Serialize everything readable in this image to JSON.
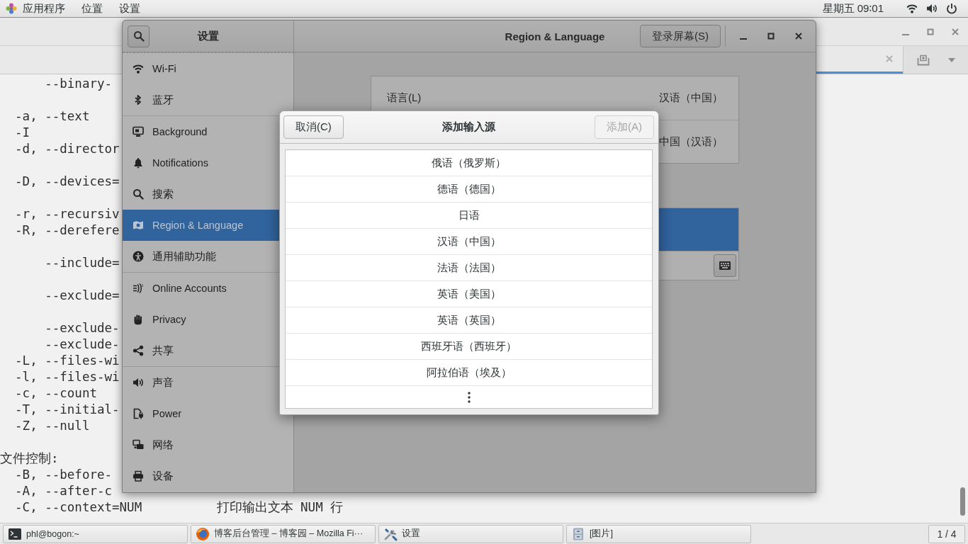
{
  "top_bar": {
    "menus": [
      "应用程序",
      "位置",
      "设置"
    ],
    "clock": "星期五 09∶01"
  },
  "terminal": {
    "tabs": [
      {
        "selected": true
      }
    ],
    "lines": [
      {
        "kind": "long",
        "text": "--binary-"
      },
      {
        "kind": "blank"
      },
      {
        "kind": "short",
        "text": "-a, --text"
      },
      {
        "kind": "short",
        "text": "-I"
      },
      {
        "kind": "short",
        "text": "-d, --director"
      },
      {
        "kind": "blank"
      },
      {
        "kind": "short",
        "text": "-D, --devices="
      },
      {
        "kind": "blank"
      },
      {
        "kind": "short",
        "text": "-r, --recursiv"
      },
      {
        "kind": "short",
        "text": "-R, --derefere"
      },
      {
        "kind": "blank"
      },
      {
        "kind": "long",
        "text": "--include="
      },
      {
        "kind": "blank"
      },
      {
        "kind": "long",
        "text": "--exclude="
      },
      {
        "kind": "blank"
      },
      {
        "kind": "long",
        "text": "--exclude-"
      },
      {
        "kind": "long",
        "text": "--exclude-"
      },
      {
        "kind": "short",
        "text": "-L, --files-wi"
      },
      {
        "kind": "short",
        "text": "-l, --files-wi"
      },
      {
        "kind": "short",
        "text": "-c, --count"
      },
      {
        "kind": "short",
        "text": "-T, --initial-"
      },
      {
        "kind": "short",
        "text": "-Z, --null"
      },
      {
        "kind": "blank"
      },
      {
        "kind": "heading",
        "text": "文件控制:"
      },
      {
        "kind": "short",
        "text": "-B, --before-"
      },
      {
        "kind": "short",
        "text": "-A, --after-c"
      },
      {
        "kind": "short",
        "text": "-C, --context=NUM",
        "description": "打印输出文本 NUM 行"
      }
    ]
  },
  "settings": {
    "title": "设置",
    "page_title": "Region & Language",
    "login_screen_button": "登录屏幕(S)",
    "sidebar_groups": [
      {
        "items": [
          {
            "label": "Wi-Fi",
            "selected": false
          },
          {
            "label": "蓝牙",
            "selected": false
          }
        ]
      },
      {
        "items": [
          {
            "label": "Background",
            "selected": false
          },
          {
            "label": "Notifications",
            "selected": false
          },
          {
            "label": "搜索",
            "selected": false
          },
          {
            "label": "Region & Language",
            "selected": true
          },
          {
            "label": "通用辅助功能",
            "selected": false
          }
        ]
      },
      {
        "items": [
          {
            "label": "Online Accounts",
            "selected": false
          },
          {
            "label": "Privacy",
            "selected": false
          },
          {
            "label": "共享",
            "selected": false
          }
        ]
      },
      {
        "items": [
          {
            "label": "声音",
            "selected": false
          },
          {
            "label": "Power",
            "selected": false
          },
          {
            "label": "网络",
            "selected": false
          },
          {
            "label": "设备",
            "selected": false
          }
        ]
      }
    ],
    "language_rows": [
      {
        "label": "语言(L)",
        "value": "汉语（中国）"
      },
      {
        "value": "中国（汉语）"
      }
    ],
    "input_sources": [
      {
        "selected": true
      }
    ]
  },
  "dialog": {
    "cancel_button": "取消(C)",
    "title": "添加输入源",
    "add_button": {
      "label": "添加(A)",
      "disabled": true
    },
    "options": [
      {
        "label": "俄语（俄罗斯）",
        "selected": false
      },
      {
        "label": "德语（德国）",
        "selected": false
      },
      {
        "label": "日语",
        "selected": false
      },
      {
        "label": "汉语（中国）",
        "selected": false
      },
      {
        "label": "法语（法国）",
        "selected": false
      },
      {
        "label": "英语（美国）",
        "selected": false
      },
      {
        "label": "英语（英国）",
        "selected": false
      },
      {
        "label": "西班牙语（西班牙）",
        "selected": false
      },
      {
        "label": "阿拉伯语（埃及）",
        "selected": false
      }
    ]
  },
  "taskbar": {
    "items": [
      "phl@bogon:~",
      "博客后台管理 – 博客园 – Mozilla Fi···",
      "设置",
      "[图片]"
    ],
    "workspace": "1 / 4"
  }
}
